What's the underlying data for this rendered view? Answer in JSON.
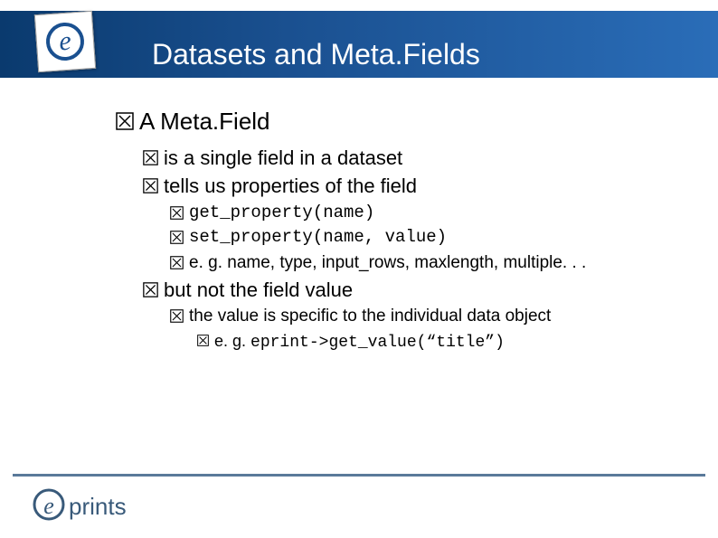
{
  "slide": {
    "title": "Datasets and Meta.Fields",
    "bullets": {
      "a": "A Meta.Field",
      "b1": "is a single field in a dataset",
      "b2": "tells us properties of the field",
      "c1": "get_property(name)",
      "c2": "set_property(name, value)",
      "c3": "e. g. name, type, input_rows, maxlength, multiple. . .",
      "b3": "but not the field value",
      "d1": "the value is specific to the individual data object",
      "e1_prefix": "e. g. ",
      "e1_code": "eprint->get_value(“title”)"
    }
  },
  "footer": {
    "brand": "eprints"
  }
}
